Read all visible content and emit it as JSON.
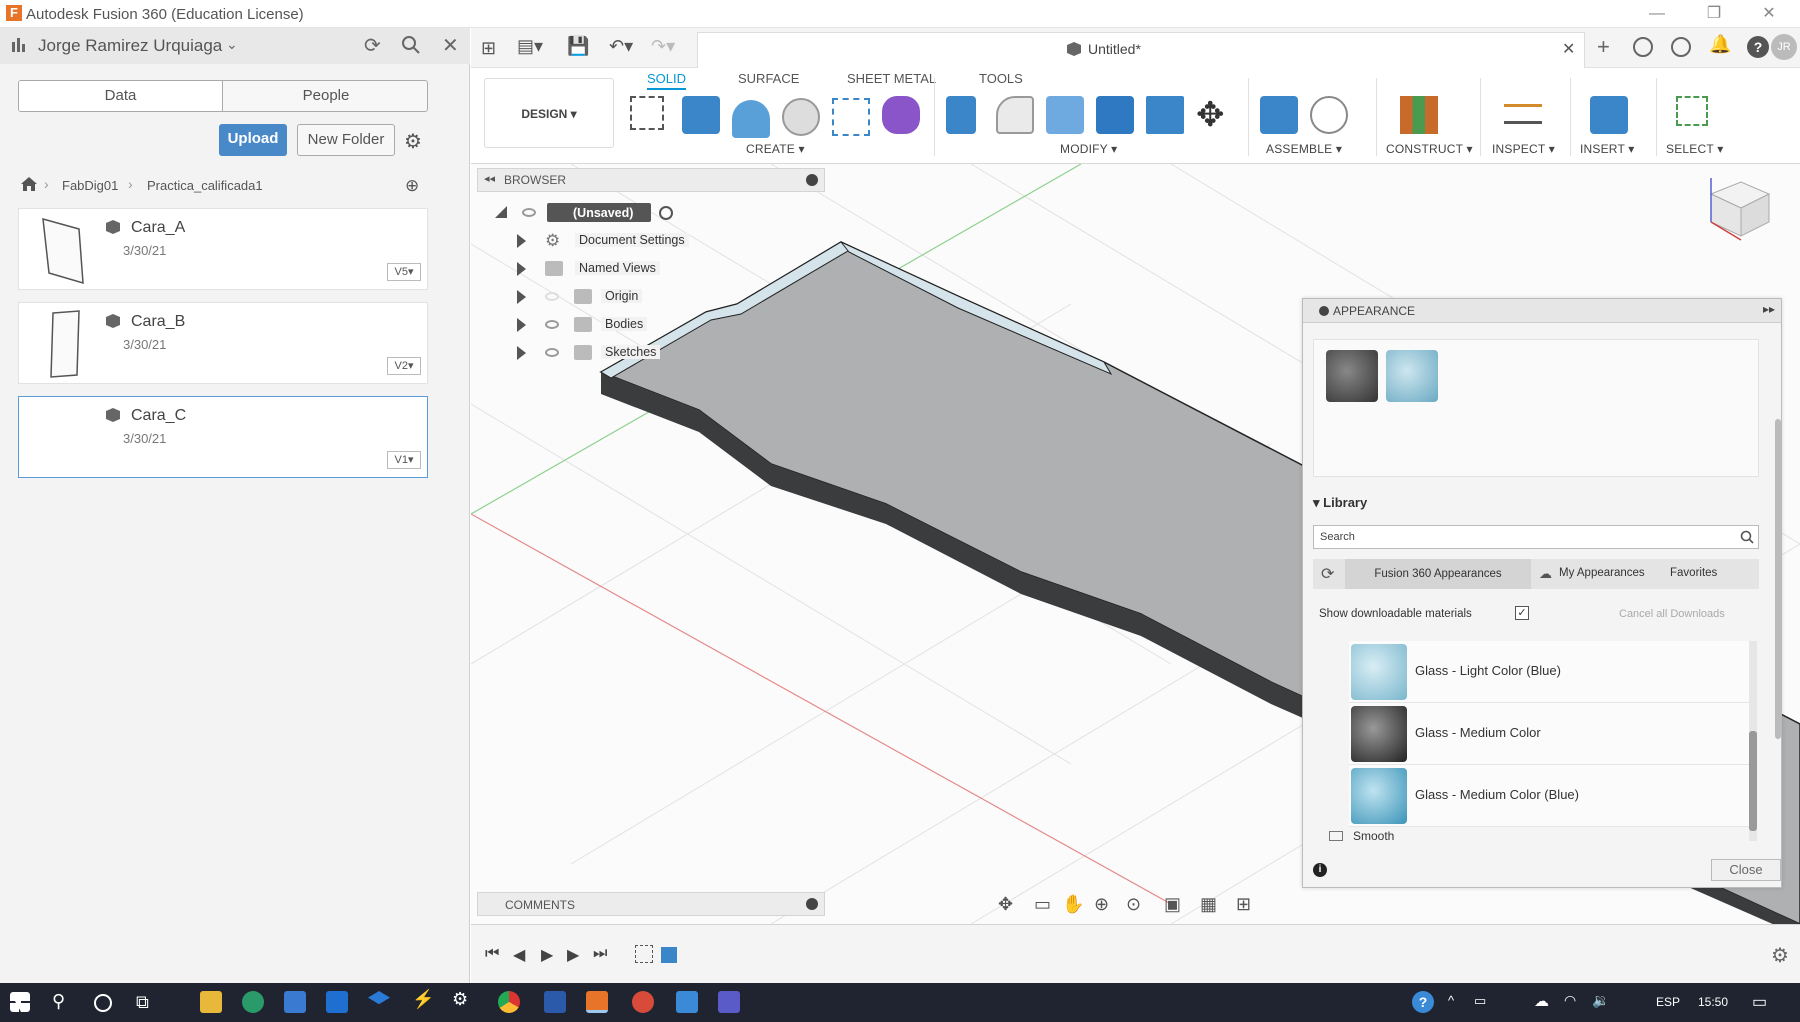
{
  "window": {
    "title": "Autodesk Fusion 360 (Education License)",
    "logo_letter": "F"
  },
  "data_panel": {
    "user": "Jorge Ramirez Urquiaga",
    "tabs": [
      "Data",
      "People"
    ],
    "upload_label": "Upload",
    "new_folder_label": "New Folder",
    "breadcrumb": [
      "FabDig01",
      "Practica_calificada1"
    ],
    "files": [
      {
        "name": "Cara_A",
        "date": "3/30/21",
        "version": "V5▾"
      },
      {
        "name": "Cara_B",
        "date": "3/30/21",
        "version": "V2▾"
      },
      {
        "name": "Cara_C",
        "date": "3/30/21",
        "version": "V1▾"
      }
    ]
  },
  "document": {
    "tab_title": "Untitled*",
    "user_initials": "JR"
  },
  "toolbar": {
    "workspace": "DESIGN ▾",
    "tabs": [
      "SOLID",
      "SURFACE",
      "SHEET METAL",
      "TOOLS"
    ],
    "active_tab": "SOLID",
    "groups": [
      "CREATE ▾",
      "MODIFY ▾",
      "ASSEMBLE ▾",
      "CONSTRUCT ▾",
      "INSPECT ▾",
      "INSERT ▾",
      "SELECT ▾"
    ]
  },
  "browser": {
    "title": "BROWSER",
    "root": "(Unsaved)",
    "items": [
      "Document Settings",
      "Named Views",
      "Origin",
      "Bodies",
      "Sketches"
    ]
  },
  "comments_label": "COMMENTS",
  "appearance": {
    "title": "APPEARANCE",
    "library_label": "Library",
    "search_placeholder": "Search",
    "lib_tabs": [
      "Fusion 360 Appearances",
      "My Appearances",
      "Favorites"
    ],
    "show_downloadable": "Show downloadable materials",
    "cancel_downloads": "Cancel all Downloads",
    "materials": [
      "Glass - Light Color (Blue)",
      "Glass - Medium Color",
      "Glass - Medium Color (Blue)"
    ],
    "next_folder": "Smooth",
    "close_label": "Close"
  },
  "taskbar": {
    "lang": "ESP",
    "time": "15:50"
  },
  "colors": {
    "accent": "#0696d7",
    "upload": "#4a89c8",
    "taskbar": "#1f2430"
  }
}
